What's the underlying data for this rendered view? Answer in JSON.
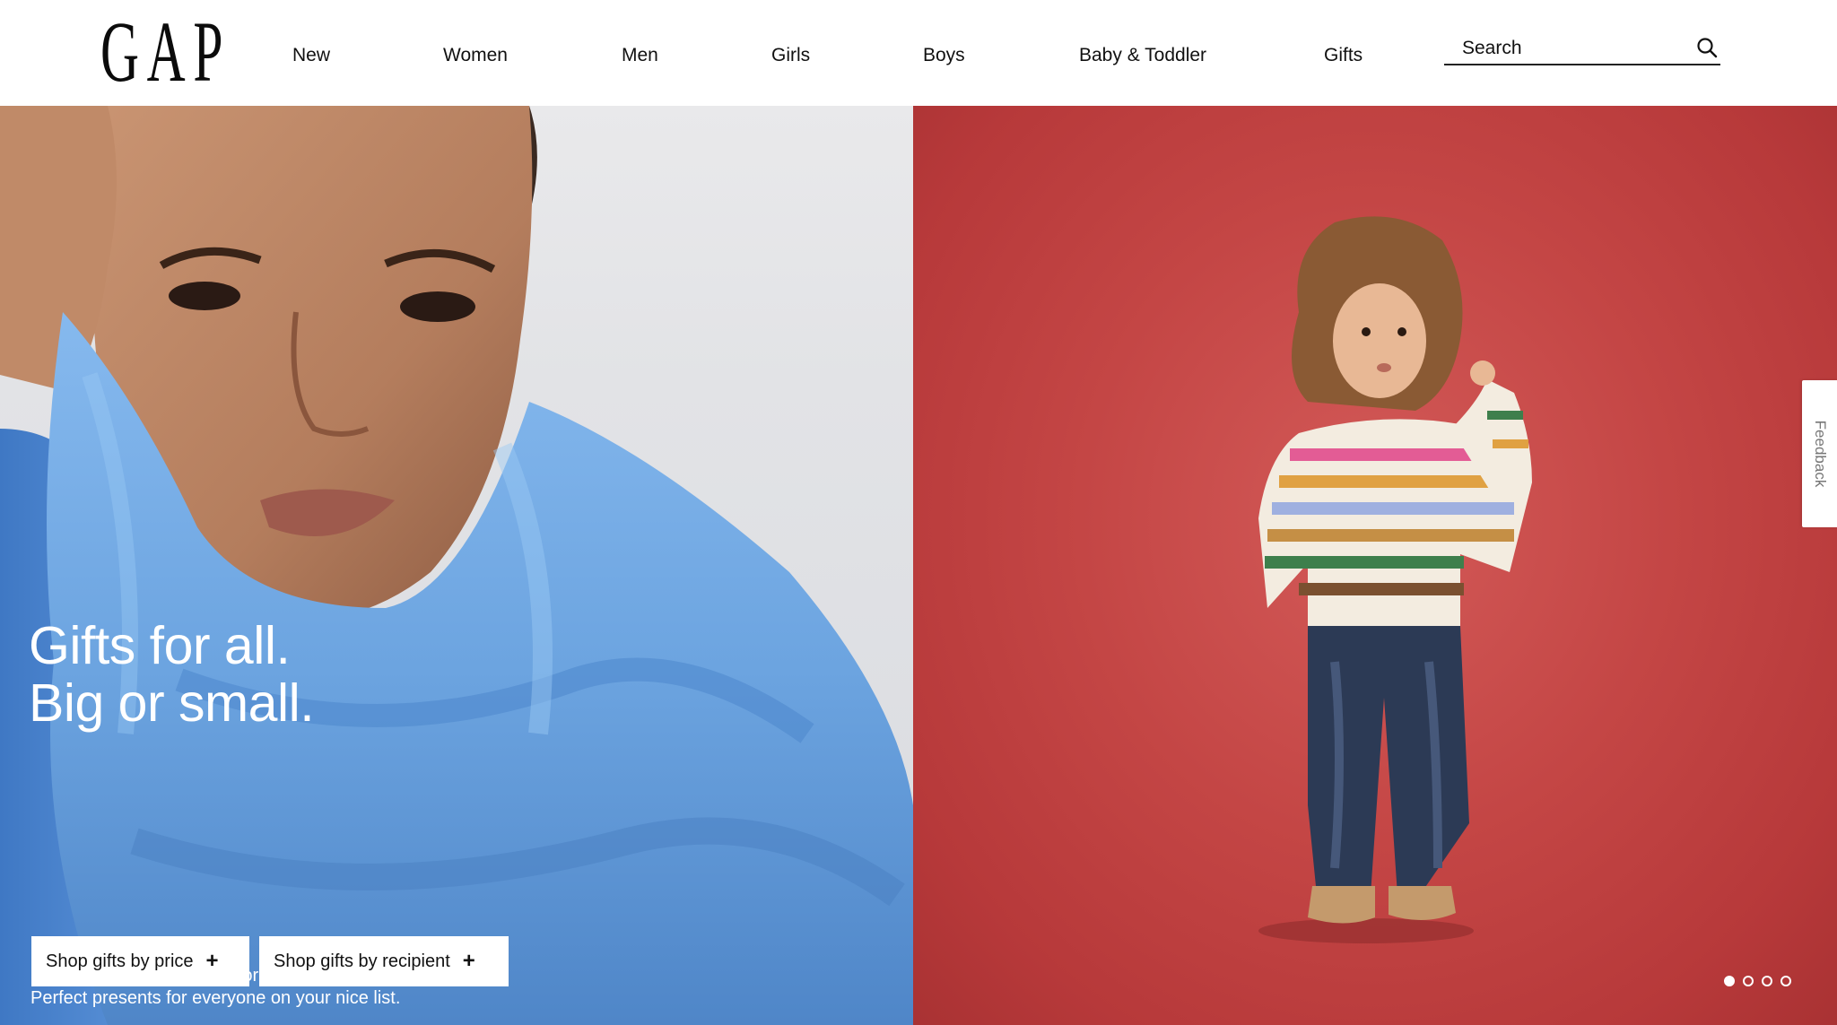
{
  "brand": {
    "logo_text": "GAP"
  },
  "nav": {
    "items": [
      {
        "label": "New"
      },
      {
        "label": "Women"
      },
      {
        "label": "Men"
      },
      {
        "label": "Girls"
      },
      {
        "label": "Boys"
      },
      {
        "label": "Baby & Toddler"
      },
      {
        "label": "Gifts"
      }
    ]
  },
  "search": {
    "placeholder": "Search",
    "icon": "search-icon"
  },
  "hero": {
    "headline_line1": "Gifts for all.",
    "headline_line2": "Big or small.",
    "subtext_line1": "Stocking stuffers. Cozy favorites.",
    "subtext_line2": "Perfect presents for everyone on your nice list.",
    "cta_price": "Shop gifts by price",
    "cta_recipient": "Shop gifts by recipient",
    "cta_icon": "+",
    "slides_total": 4,
    "slide_active": 1
  },
  "feedback": {
    "label": "Feedback"
  },
  "colors": {
    "hero_right_bg": "#c44645",
    "scarf_blue": "#6aa6e6",
    "text_on_image": "#ffffff"
  }
}
